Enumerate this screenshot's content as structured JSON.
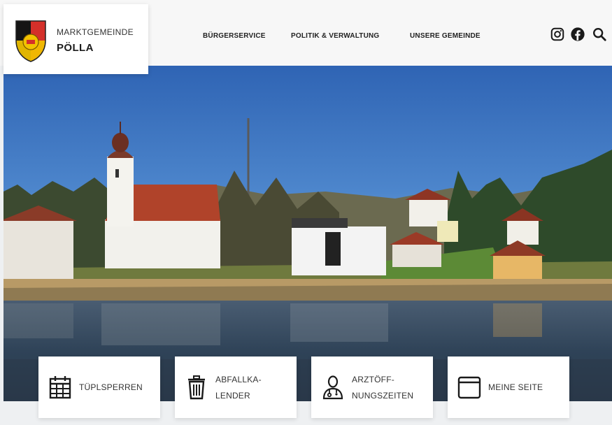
{
  "header": {
    "logo": {
      "line1": "MARKTGEMEINDE",
      "line2": "PÖLLA",
      "crest_icon": "coat-of-arms-icon"
    },
    "nav": [
      {
        "label": "BÜRGERSERVICE"
      },
      {
        "label": "POLITIK & VERWALTUNG"
      },
      {
        "label": "UNSERE GEMEINDE"
      }
    ],
    "icons": [
      "instagram-icon",
      "facebook-icon",
      "search-icon"
    ]
  },
  "hero": {
    "slides_count": 4,
    "active_slide": 1
  },
  "tiles": [
    {
      "label_lines": [
        "TÜPLSPERREN"
      ],
      "icon": "calendar-icon"
    },
    {
      "label_lines": [
        "ABFALLKA-",
        "LENDER"
      ],
      "icon": "trash-icon"
    },
    {
      "label_lines": [
        "ARZTÖFF-",
        "NUNGSZEITEN"
      ],
      "icon": "doctor-icon"
    },
    {
      "label_lines": [
        "MEINE SEITE"
      ],
      "icon": "browser-window-icon"
    }
  ],
  "colors": {
    "header_bg": "#f7f7f7",
    "tile_bg": "#ffffff",
    "text": "#222222",
    "crest_red": "#d4302a",
    "crest_yellow": "#f2c300",
    "crest_black": "#151515"
  }
}
